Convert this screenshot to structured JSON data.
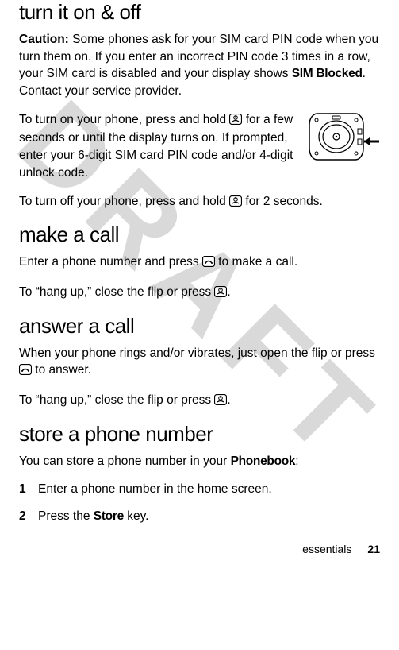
{
  "watermark": "DRAFT",
  "sections": {
    "turn": {
      "heading": "turn it on & off",
      "caution_label": "Caution:",
      "caution_text_1": " Some phones ask for your SIM card PIN code when you turn them on. If you enter an incorrect PIN code 3 times in a row, your SIM card is disabled and your display shows ",
      "caution_bold": "SIM Blocked",
      "caution_text_2": ". Contact your service provider.",
      "on_text_1": "To turn on your phone, press and hold ",
      "on_text_2": " for a few seconds or until the display turns on. If prompted, enter your 6-digit SIM card PIN code and/or 4-digit unlock code.",
      "off_text_1": "To turn off your phone, press and hold ",
      "off_text_2": " for 2 seconds."
    },
    "make": {
      "heading": "make a call",
      "p1_a": "Enter a phone number and press ",
      "p1_b": " to make a call.",
      "p2_a": "To “hang up,” close the flip or press ",
      "p2_b": "."
    },
    "answer": {
      "heading": "answer a call",
      "p1_a": "When your phone rings and/or vibrates, just open the flip or press ",
      "p1_b": " to answer.",
      "p2_a": "To “hang up,” close the flip or press ",
      "p2_b": "."
    },
    "store": {
      "heading": "store a phone number",
      "intro_a": "You can store a phone number in your ",
      "intro_bold": "Phonebook",
      "intro_b": ":",
      "steps": {
        "s1": "Enter a phone number in the home screen.",
        "s2_a": "Press the ",
        "s2_bold": "Store",
        "s2_b": " key."
      }
    }
  },
  "icons": {
    "power_key": "power-end-key-icon",
    "send_key": "send-key-icon"
  },
  "footer": {
    "label": "essentials",
    "page": "21"
  }
}
